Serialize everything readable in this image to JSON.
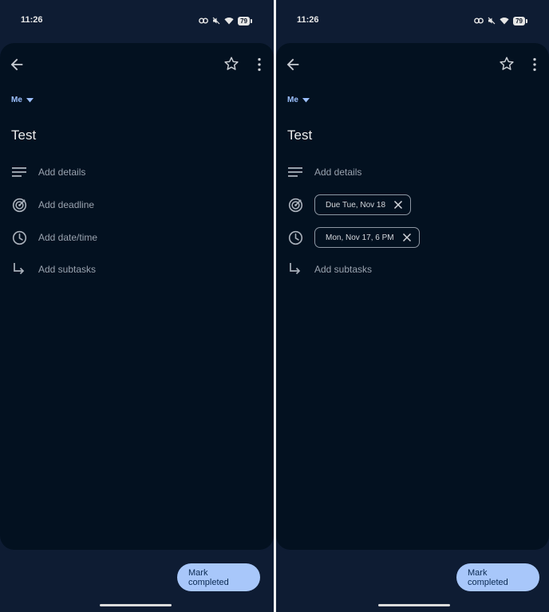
{
  "screens": [
    {
      "status": {
        "time": "11:26",
        "battery": "79"
      },
      "assignee": "Me",
      "title": "Test",
      "details_label": "Add details",
      "deadline_label": "Add deadline",
      "datetime_label": "Add date/time",
      "subtasks_label": "Add subtasks",
      "fab_label": "Mark completed"
    },
    {
      "status": {
        "time": "11:26",
        "battery": "79"
      },
      "assignee": "Me",
      "title": "Test",
      "details_label": "Add details",
      "deadline_chip": "Due Tue, Nov 18",
      "datetime_chip": "Mon, Nov 17, 6 PM",
      "subtasks_label": "Add subtasks",
      "fab_label": "Mark completed"
    }
  ],
  "colors": {
    "accent": "#9cc0ff",
    "fab_bg": "#a8c7fa",
    "sheet_bg": "#031120",
    "frame_bg": "#0e1c33"
  },
  "icons": {
    "back": "arrow-left-icon",
    "star": "star-outline-icon",
    "more": "more-vert-icon",
    "details": "notes-lines-icon",
    "deadline": "target-icon",
    "datetime": "clock-icon",
    "subtasks": "subdirectory-arrow-icon",
    "clear": "close-icon"
  }
}
